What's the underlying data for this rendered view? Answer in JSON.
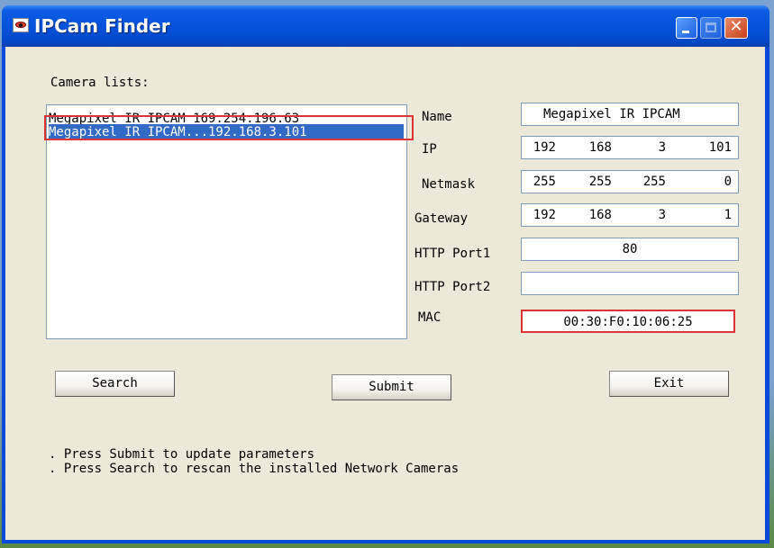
{
  "window": {
    "title": "IPCam Finder"
  },
  "camera_list": {
    "label": "Camera lists:",
    "items": [
      {
        "name": "Megapixel IR IPCAM",
        "ip": "169.254.196.63",
        "text": "Megapixel IR IPCAM   169.254.196.63"
      },
      {
        "name": "Megapixel IR IPCAM",
        "ip": "192.168.3.101",
        "text": "Megapixel IR IPCAM...192.168.3.101",
        "selected": true
      }
    ]
  },
  "fields": {
    "name": {
      "label": "Name",
      "value": "Megapixel IR IPCAM"
    },
    "ip": {
      "label": "IP",
      "octets": [
        "192",
        "168",
        "3",
        "101"
      ]
    },
    "netmask": {
      "label": "Netmask",
      "octets": [
        "255",
        "255",
        "255",
        "0"
      ]
    },
    "gateway": {
      "label": "Gateway",
      "octets": [
        "192",
        "168",
        "3",
        "1"
      ]
    },
    "http_port1": {
      "label": "HTTP Port1",
      "value": "80"
    },
    "http_port2": {
      "label": "HTTP Port2",
      "value": ""
    },
    "mac": {
      "label": "MAC",
      "value": "00:30:F0:10:06:25"
    }
  },
  "buttons": {
    "search": "Search",
    "submit": "Submit",
    "exit": "Exit"
  },
  "hints": [
    ". Press Submit to update parameters",
    ". Press Search to rescan the installed Network Cameras"
  ],
  "colors": {
    "title_bar": "#0553dd",
    "highlight_box": "#dd3333",
    "selection": "#316ac5"
  }
}
